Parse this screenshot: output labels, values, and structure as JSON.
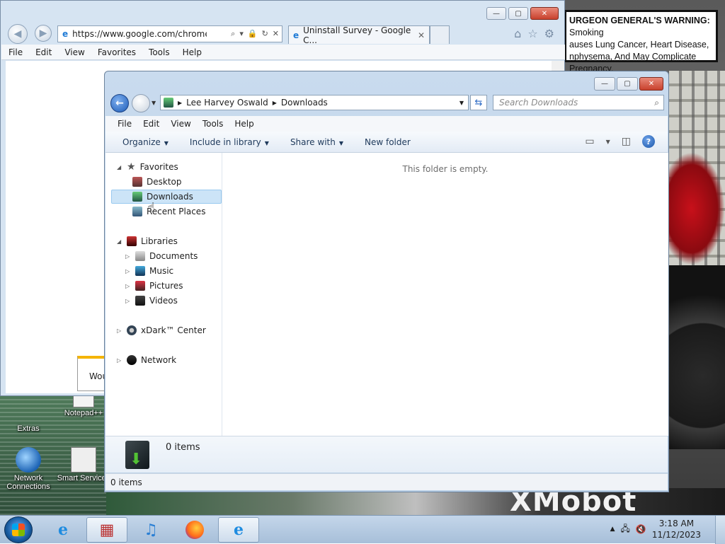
{
  "warning": {
    "bold": "URGEON GENERAL'S WARNING:",
    "rest": "Smoking",
    "line2": "auses Lung Cancer, Heart Disease,",
    "line3": "nphysema, And May Complicate Pregnancy."
  },
  "background_logo": "XMobot",
  "desktop_icons": [
    {
      "label": "Extras"
    },
    {
      "label": "Notepad++"
    },
    {
      "label": "Network Connections"
    },
    {
      "label": "Smart Services"
    }
  ],
  "ie": {
    "url": "https://www.google.com/chrome/",
    "tab_title": "Uninstall Survey - Google C...",
    "menu": [
      "File",
      "Edit",
      "View",
      "Favorites",
      "Tools",
      "Help"
    ],
    "dialog_text": "Wou"
  },
  "explorer": {
    "breadcrumb": [
      "Lee Harvey Oswald",
      "Downloads"
    ],
    "search_placeholder": "Search Downloads",
    "menu": [
      "File",
      "Edit",
      "View",
      "Tools",
      "Help"
    ],
    "commands": {
      "organize": "Organize",
      "include": "Include in library",
      "share": "Share with",
      "new_folder": "New folder"
    },
    "nav": {
      "favorites": "Favorites",
      "desktop": "Desktop",
      "downloads": "Downloads",
      "recent": "Recent Places",
      "libraries": "Libraries",
      "documents": "Documents",
      "music": "Music",
      "pictures": "Pictures",
      "videos": "Videos",
      "xdark": "xDark™ Center",
      "network": "Network"
    },
    "empty_message": "This folder is empty.",
    "details_count": "0 items",
    "status_count": "0 items"
  },
  "taskbar": {
    "time": "3:18 AM",
    "date": "11/12/2023"
  },
  "colors": {
    "selection": "#cce4f7",
    "accent": "#1d5cb8"
  }
}
